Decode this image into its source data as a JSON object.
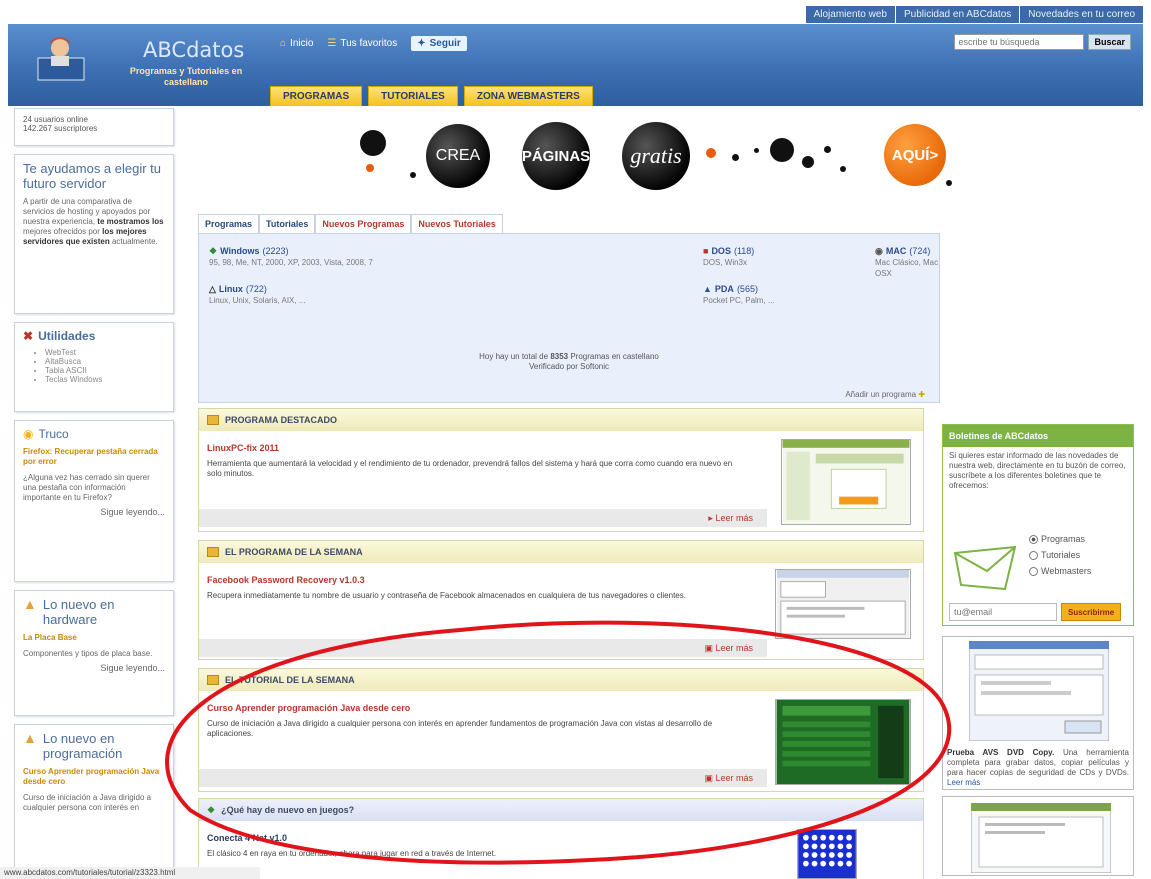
{
  "top_links": [
    "Alojamiento web",
    "Publicidad en ABCdatos",
    "Novedades en tu correo"
  ],
  "header": {
    "logo_title": "ABCdatos",
    "logo_subtitle": "Programas y Tutoriales en castellano",
    "nav_inicio": "Inicio",
    "nav_favoritos": "Tus favoritos",
    "follow_label": "Seguir",
    "search_placeholder": "escribe tu búsqueda",
    "search_button": "Buscar",
    "tabs": [
      "PROGRAMAS",
      "TUTORIALES",
      "ZONA WEBMASTERS"
    ]
  },
  "left": {
    "online_line1": "24 usuarios online",
    "online_line2": "142.267 suscriptores",
    "hosting_title": "Te ayudamos a elegir tu futuro servidor",
    "hosting_text": "A partir de una comparativa de servicios de hosting y apoyados por nuestra experiencia,",
    "hosting_bold1": "te mostramos los",
    "hosting_text2": "mejores ofrecidos por",
    "hosting_bold2": "los mejores servidores que existen",
    "hosting_text3": "actualmente.",
    "util_title": "Utilidades",
    "util_items": [
      "WebTest",
      "AltaBusca",
      "Tabla ASCII",
      "Teclas Windows"
    ],
    "tip_title": "Truco",
    "tip_link": "Firefox: Recuperar pestaña cerrada por error",
    "tip_text": "¿Alguna vez has cerrado sin querer una pestaña con información importante en tu Firefox?",
    "tip_more": "Sigue leyendo...",
    "hw_title": "Lo nuevo en hardware",
    "hw_link": "La Placa Base",
    "hw_text": "Componentes y tipos de placa base.",
    "hw_more": "Sigue leyendo...",
    "prog_title": "Lo nuevo en programación",
    "prog_link": "Curso Aprender programación Java desde cero",
    "prog_text": "Curso de iniciación a Java dirigido a cualquier persona con interés en"
  },
  "categories": {
    "tabs": [
      "Programas",
      "Tutoriales",
      "Nuevos Programas",
      "Nuevos Tutoriales"
    ],
    "items": [
      {
        "name": "Windows",
        "count": "(2223)",
        "sub": "95, 98, Me, NT, 2000, XP, 2003, Vista, 2008, 7"
      },
      {
        "name": "DOS",
        "count": "(118)",
        "sub": "DOS, Win3x"
      },
      {
        "name": "MAC",
        "count": "(724)",
        "sub": "Mac Clásico, Mac OSX"
      },
      {
        "name": "Linux",
        "count": "(722)",
        "sub": "Linux, Unix, Solaris, AIX, ..."
      },
      {
        "name": "PDA",
        "count": "(565)",
        "sub": "Pocket PC, Palm, ..."
      }
    ],
    "total_pre": "Hoy hay un total de",
    "total_num": "8353",
    "total_post": "Programas en castellano",
    "verified": "Verificado por Softonic",
    "add_program": "Añadir un programa"
  },
  "banner": {
    "crea": "CREA",
    "paginas": "PÁGINAS",
    "gratis": "gratis",
    "aqui": "AQUÍ>"
  },
  "sections": {
    "featured_head": "PROGRAMA DESTACADO",
    "featured_title": "LinuxPC-fix 2011",
    "featured_desc": "Herramienta que aumentará la velocidad y el rendimiento de tu ordenador, prevendrá fallos del sistema y hará que corra como cuando era nuevo en solo minutos.",
    "featured_more": "Leer más",
    "week_prog_head": "EL PROGRAMA DE LA SEMANA",
    "week_prog_title": "Facebook Password Recovery v1.0.3",
    "week_prog_desc": "Recupera inmediatamente tu nombre de usuario y contraseña de Facebook almacenados en cualquiera de tus navegadores o clientes.",
    "week_prog_more": "Leer más",
    "week_tut_head": "EL TUTORIAL DE LA SEMANA",
    "week_tut_title": "Curso Aprender programación Java desde cero",
    "week_tut_desc": "Curso de iniciación a Java dirigido a cualquier persona con interés en aprender fundamentos de programación Java con vistas al desarrollo de aplicaciones.",
    "week_tut_more": "Leer más",
    "games_head": "¿Qué hay de nuevo en juegos?",
    "games_title": "Conecta 4 Net v1.0",
    "games_desc": "El clásico 4 en raya en tu ordenador, ahora para jugar en red a través de Internet."
  },
  "right": {
    "news_head": "Boletines de ABCdatos",
    "news_text": "Si quieres estar informado de las novedades de nuestra web, directamente en tu buzón de correo, suscríbete a los diferentes boletines que te ofrecemos:",
    "radio_options": [
      "Programas",
      "Tutoriales",
      "Webmasters"
    ],
    "email_placeholder": "tu@email",
    "subscribe": "Suscribirme",
    "avs_bold": "Prueba AVS DVD Copy.",
    "avs_text": "Una herramienta completa para grabar datos, copiar películas y para hacer copias de seguridad de CDs y DVDs.",
    "avs_more": "Leer más"
  },
  "status_url": "www.abcdatos.com/tutoriales/tutorial/z3323.html"
}
